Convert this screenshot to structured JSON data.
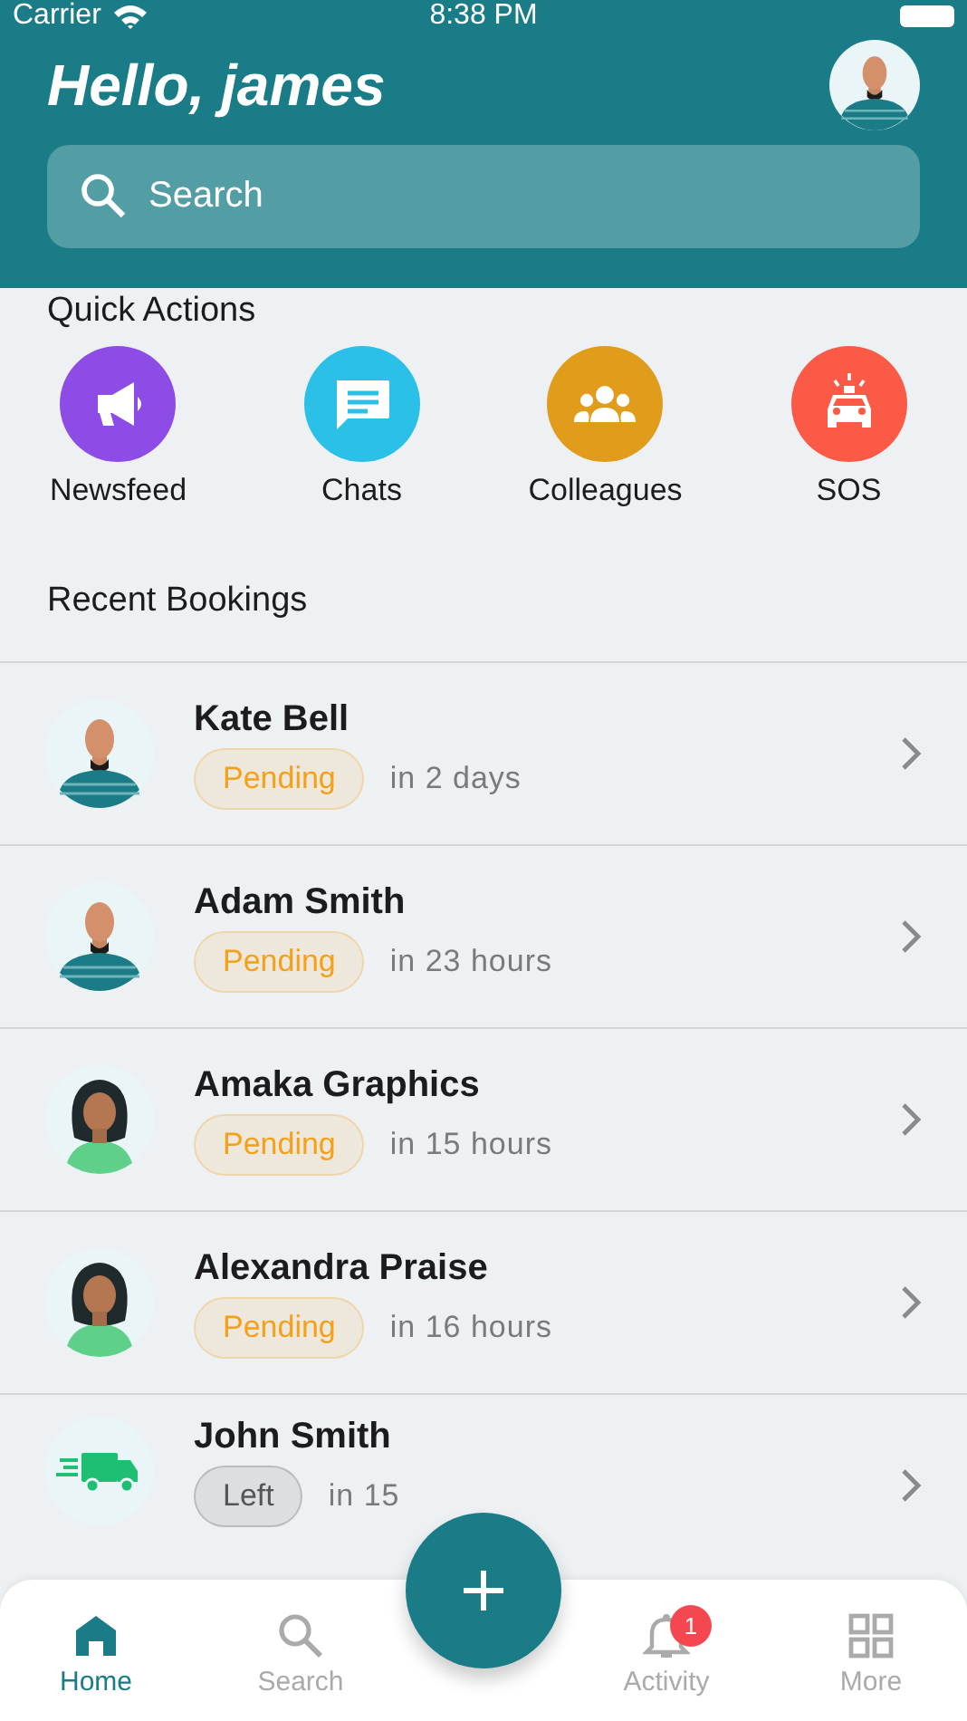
{
  "status_bar": {
    "carrier": "Carrier",
    "time": "8:38 PM"
  },
  "header": {
    "greeting": "Hello, james",
    "search": {
      "placeholder": "Search"
    }
  },
  "quick_actions": {
    "title": "Quick Actions",
    "items": [
      {
        "label": "Newsfeed",
        "kind": "megaphone",
        "color": "#8e4ce6"
      },
      {
        "label": "Chats",
        "kind": "chat",
        "color": "#2bc0e8"
      },
      {
        "label": "Colleagues",
        "kind": "people",
        "color": "#e09c1a"
      },
      {
        "label": "SOS",
        "kind": "car",
        "color": "#fb5a47"
      }
    ]
  },
  "recent_bookings": {
    "title": "Recent Bookings",
    "items": [
      {
        "name": "Kate Bell",
        "kind": "man",
        "status": {
          "label": "Pending",
          "color": "#f4a019"
        },
        "time": "in 2 days"
      },
      {
        "name": "Adam Smith",
        "kind": "man",
        "status": {
          "label": "Pending",
          "color": "#f4a019"
        },
        "time": "in 23 hours"
      },
      {
        "name": "Amaka Graphics",
        "kind": "woman",
        "status": {
          "label": "Pending",
          "color": "#f4a019"
        },
        "time": "in 15 hours"
      },
      {
        "name": "Alexandra Praise",
        "kind": "woman",
        "status": {
          "label": "Pending",
          "color": "#f4a019"
        },
        "time": "in 16 hours"
      },
      {
        "name": "John Smith",
        "kind": "truck",
        "status": {
          "label": "Left",
          "color": "#555555"
        },
        "time": "in 15"
      }
    ]
  },
  "tab_bar": [
    {
      "label": "Home",
      "kind": "home",
      "selected": true
    },
    {
      "label": "Search",
      "kind": "search",
      "selected": false
    },
    {
      "label": "Activity",
      "kind": "bell",
      "selected": false,
      "badge": "1"
    },
    {
      "label": "More",
      "kind": "grid",
      "selected": false
    }
  ]
}
